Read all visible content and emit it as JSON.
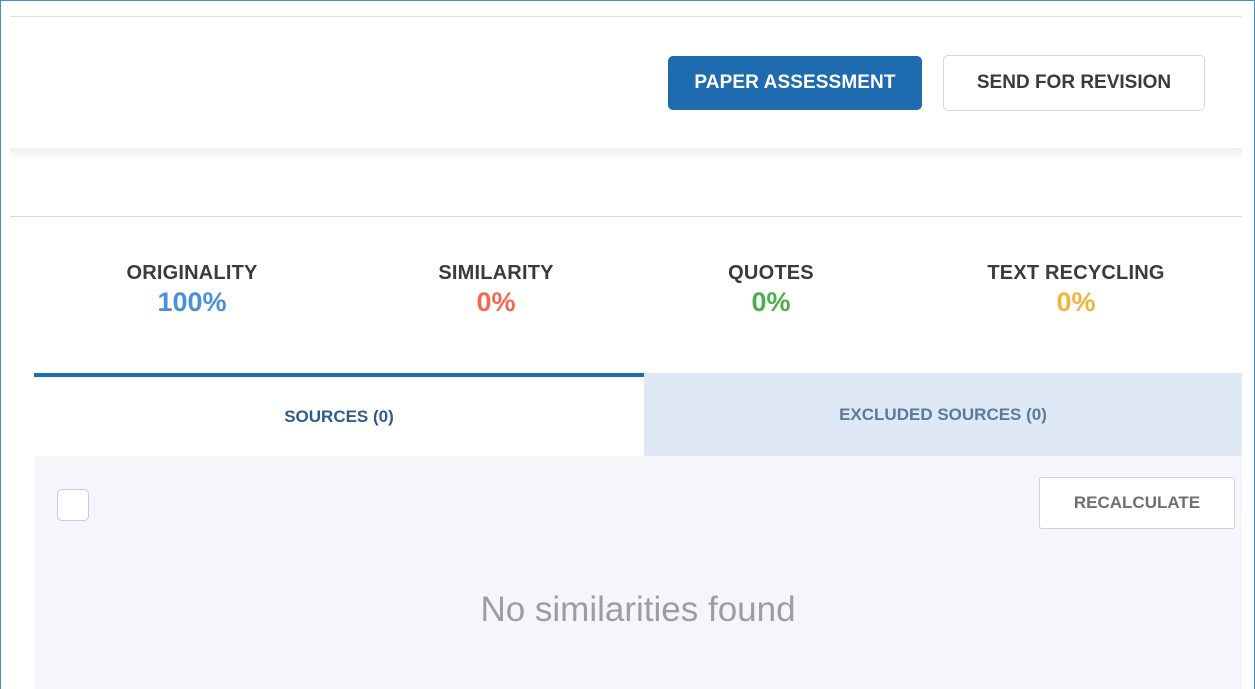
{
  "header": {
    "primary_button": "PAPER ASSESSMENT",
    "secondary_button": "SEND FOR REVISION"
  },
  "stats": [
    {
      "label": "ORIGINALITY",
      "value": "100%",
      "color": "#4a90d9"
    },
    {
      "label": "SIMILARITY",
      "value": "0%",
      "color": "#ef6a4e"
    },
    {
      "label": "QUOTES",
      "value": "0%",
      "color": "#4cae4f"
    },
    {
      "label": "TEXT RECYCLING",
      "value": "0%",
      "color": "#f0b43a"
    }
  ],
  "tabs": {
    "sources": "SOURCES (0)",
    "excluded": "EXCLUDED SOURCES (0)"
  },
  "panel": {
    "recalculate_button": "RECALCULATE",
    "empty_message": "No similarities found"
  },
  "colors": {
    "accent": "#1e6bb0",
    "tab_inactive_bg": "#dfe9f6",
    "panel_bg": "#f5f6fa"
  }
}
